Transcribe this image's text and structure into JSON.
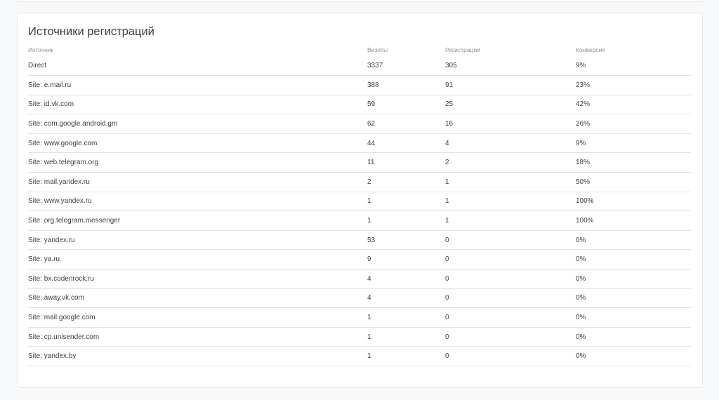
{
  "report": {
    "title": "Источники регистраций",
    "columns": [
      "Источник",
      "Визиты",
      "Регистрации",
      "Конверсия"
    ],
    "rows": [
      [
        "Direct",
        "3337",
        "305",
        "9%"
      ],
      [
        "Site: e.mail.ru",
        "388",
        "91",
        "23%"
      ],
      [
        "Site: id.vk.com",
        "59",
        "25",
        "42%"
      ],
      [
        "Site: com.google.android.gm",
        "62",
        "16",
        "26%"
      ],
      [
        "Site: www.google.com",
        "44",
        "4",
        "9%"
      ],
      [
        "Site: web.telegram.org",
        "11",
        "2",
        "18%"
      ],
      [
        "Site: mail.yandex.ru",
        "2",
        "1",
        "50%"
      ],
      [
        "Site: www.yandex.ru",
        "1",
        "1",
        "100%"
      ],
      [
        "Site: org.telegram.messenger",
        "1",
        "1",
        "100%"
      ],
      [
        "Site: yandex.ru",
        "53",
        "0",
        "0%"
      ],
      [
        "Site: ya.ru",
        "9",
        "0",
        "0%"
      ],
      [
        "Site: bx.codenrock.ru",
        "4",
        "0",
        "0%"
      ],
      [
        "Site: away.vk.com",
        "4",
        "0",
        "0%"
      ],
      [
        "Site: mail.google.com",
        "1",
        "0",
        "0%"
      ],
      [
        "Site: cp.unisender.com",
        "1",
        "0",
        "0%"
      ],
      [
        "Site: yandex.by",
        "1",
        "0",
        "0%"
      ]
    ]
  },
  "colors": {
    "border": "#dee1ea",
    "card_border": "#e4e6ea",
    "header_text": "#8a9099",
    "text": "#3a3f47"
  }
}
